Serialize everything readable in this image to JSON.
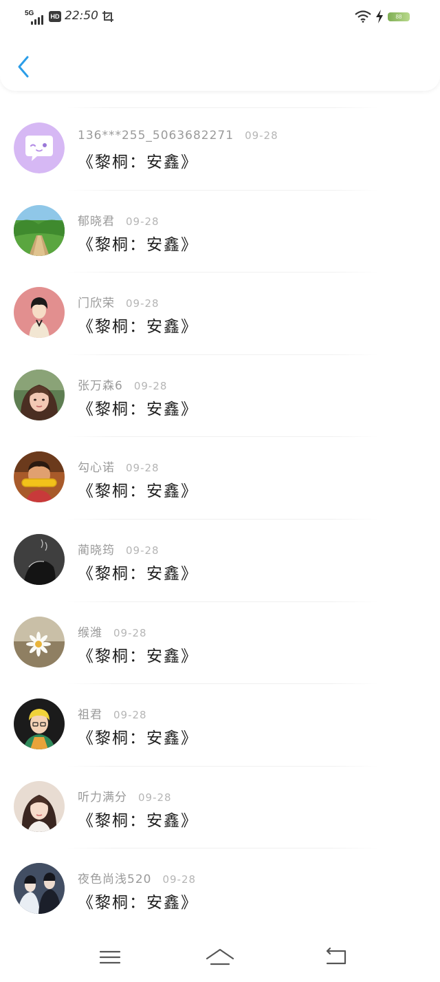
{
  "status_bar": {
    "network": "5G",
    "hd": "HD",
    "time": "22:50",
    "battery": "88",
    "icons": [
      "signal-icon",
      "hd-icon",
      "screenshot-icon",
      "wifi-icon",
      "charging-icon",
      "battery-icon"
    ]
  },
  "nav": {
    "back_icon": "chevron-left-icon",
    "accent": "#2b9de8"
  },
  "comments": [
    {
      "user": "136***255_5063682271",
      "date": "09-28",
      "text": "《黎桐：安鑫》",
      "avatar": "chat-bubble-avatar"
    },
    {
      "user": "郁晓君",
      "date": "09-28",
      "text": "《黎桐：安鑫》",
      "avatar": "landscape-avatar"
    },
    {
      "user": "门欣荣",
      "date": "09-28",
      "text": "《黎桐：安鑫》",
      "avatar": "anime-boy-avatar"
    },
    {
      "user": "张万森6",
      "date": "09-28",
      "text": "《黎桐：安鑫》",
      "avatar": "girl-photo-avatar"
    },
    {
      "user": "勾心诺",
      "date": "09-28",
      "text": "《黎桐：安鑫》",
      "avatar": "kid-corn-avatar"
    },
    {
      "user": "蔺晓筠",
      "date": "09-28",
      "text": "《黎桐：安鑫》",
      "avatar": "smoke-portrait-avatar"
    },
    {
      "user": "缑潍",
      "date": "09-28",
      "text": "《黎桐：安鑫》",
      "avatar": "daisy-avatar"
    },
    {
      "user": "祖君",
      "date": "09-28",
      "text": "《黎桐：安鑫》",
      "avatar": "cartoon-boy-avatar"
    },
    {
      "user": "听力满分",
      "date": "09-28",
      "text": "《黎桐：安鑫》",
      "avatar": "girl-selfie-avatar"
    },
    {
      "user": "夜色尚浅520",
      "date": "09-28",
      "text": "《黎桐：安鑫》",
      "avatar": "couple-avatar"
    }
  ],
  "bottom_nav": {
    "icons": [
      "menu-icon",
      "home-icon",
      "back-icon"
    ]
  }
}
